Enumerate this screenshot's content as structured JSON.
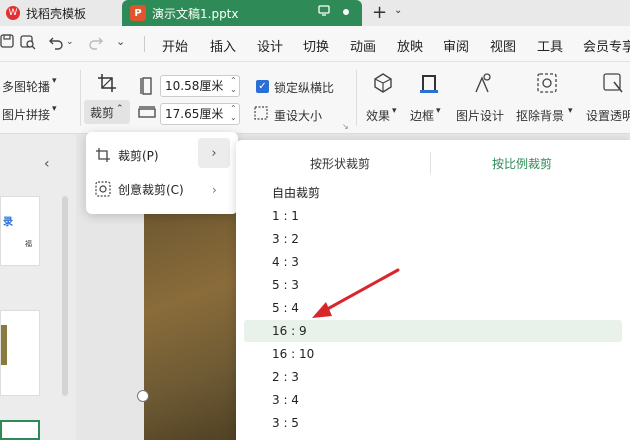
{
  "tabs": {
    "inactive_label": "找稻壳模板",
    "active_label": "演示文稿1.pptx",
    "wps_glyph": "W",
    "ppt_glyph": "P"
  },
  "menu": {
    "items": [
      "开始",
      "插入",
      "设计",
      "切换",
      "动画",
      "放映",
      "审阅",
      "视图",
      "工具",
      "会员专享"
    ]
  },
  "ribbon": {
    "multi_outline": "多图轮播",
    "image_mosaic": "图片拼接",
    "crop_label": "裁剪",
    "width_value": "10.58厘米",
    "height_value": "17.65厘米",
    "lock_ratio": "锁定纵横比",
    "reset_size": "重设大小",
    "effects": "效果",
    "border": "边框",
    "image_design": "图片设计",
    "remove_bg": "抠除背景",
    "set_transparent": "设置透明"
  },
  "thumbs": {
    "slide1_text": "录",
    "slide1_small": "福"
  },
  "crop_menu": {
    "items": [
      "裁剪(P)",
      "创意裁剪(C)"
    ]
  },
  "submenu": {
    "tab_shape": "按形状裁剪",
    "tab_ratio": "按比例裁剪",
    "free_crop": "自由裁剪",
    "ratios": [
      "1 : 1",
      "3 : 2",
      "4 : 3",
      "5 : 3",
      "5 : 4",
      "16 : 9",
      "16 : 10",
      "2 : 3",
      "3 : 4",
      "3 : 5"
    ],
    "highlighted_index": 5
  },
  "colors": {
    "accent": "#2e8b57",
    "checkbox": "#2a6fd6",
    "annotation_arrow": "#d9262a"
  }
}
